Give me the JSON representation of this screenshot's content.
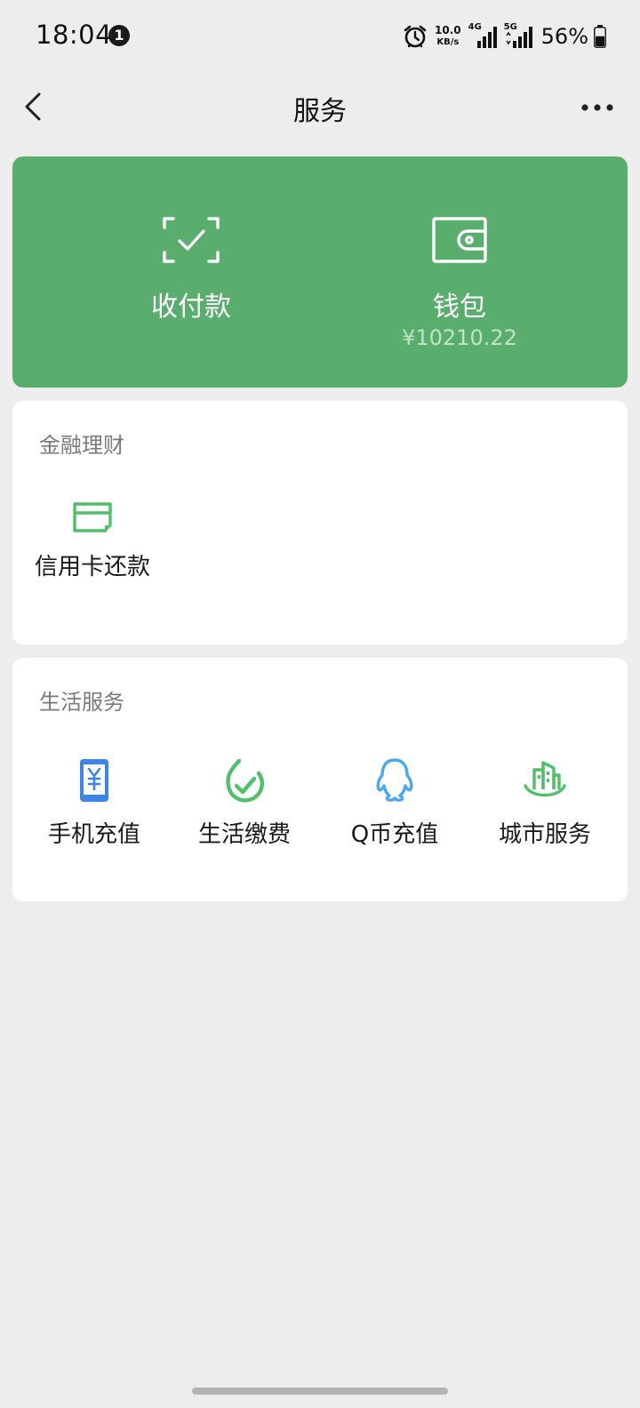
{
  "status_bar": {
    "time": "18:04",
    "notification_count": "1",
    "net_speed_value": "10.0",
    "net_speed_unit": "KB/s",
    "signal_1_label": "4G",
    "signal_2_label": "5G",
    "battery_percent": "56%",
    "battery_level": 0.56
  },
  "nav": {
    "title": "服务",
    "back_icon": "chevron-left-icon",
    "more_icon": "more-dots-icon"
  },
  "pay_card": {
    "color": "#59ad6d",
    "collect": {
      "label": "收付款",
      "icon": "scan-check-icon"
    },
    "wallet": {
      "label": "钱包",
      "balance": "¥10210.22",
      "icon": "wallet-icon"
    }
  },
  "finance": {
    "title": "金融理财",
    "items": [
      {
        "label": "信用卡还款",
        "icon": "credit-card-icon",
        "color": "#4fbf6a"
      }
    ]
  },
  "life": {
    "title": "生活服务",
    "items": [
      {
        "label": "手机充值",
        "icon": "phone-recharge-icon",
        "color": "#3d86e8"
      },
      {
        "label": "生活缴费",
        "icon": "utility-payment-icon",
        "color": "#4fbf6a"
      },
      {
        "label": "Q币充值",
        "icon": "qq-penguin-icon",
        "color": "#4aa8f0"
      },
      {
        "label": "城市服务",
        "icon": "city-service-icon",
        "color": "#4fbf6a"
      }
    ]
  }
}
